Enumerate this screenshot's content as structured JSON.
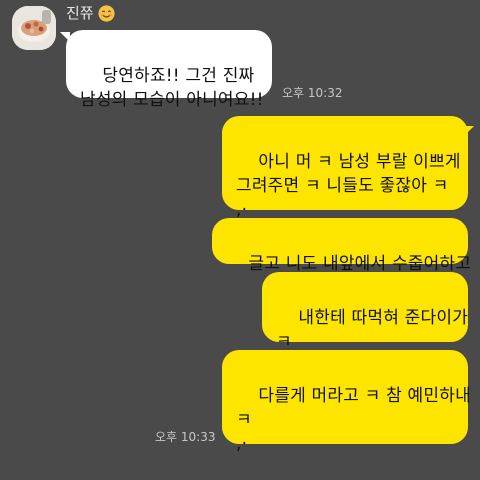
{
  "chat": {
    "sender": {
      "name": "진쮸",
      "avatar_icon": "avatar-photo",
      "status_emoji": "smiling-face-emoji"
    },
    "messages": [
      {
        "direction": "in",
        "text": "당연하죠!! 그건 진짜\n남성의 모습이 아니여요!!",
        "time": "오후 10:32"
      },
      {
        "direction": "out",
        "text": "아니 머 ㅋ 남성 부랄 이쁘게\n그려주면 ㅋ 니들도 좋잖아 ㅋ\n,·",
        "time": ""
      },
      {
        "direction": "out",
        "text": "글고 니도 내앞에서 수줍어하고",
        "time": ""
      },
      {
        "direction": "out",
        "text": "내한테 따먹혀 준다이가\nㅋ",
        "time": ""
      },
      {
        "direction": "out",
        "text": "다를게 머라고 ㅋ 참 예민하내\nㅋ\n,·",
        "time": "오후 10:33"
      }
    ]
  }
}
